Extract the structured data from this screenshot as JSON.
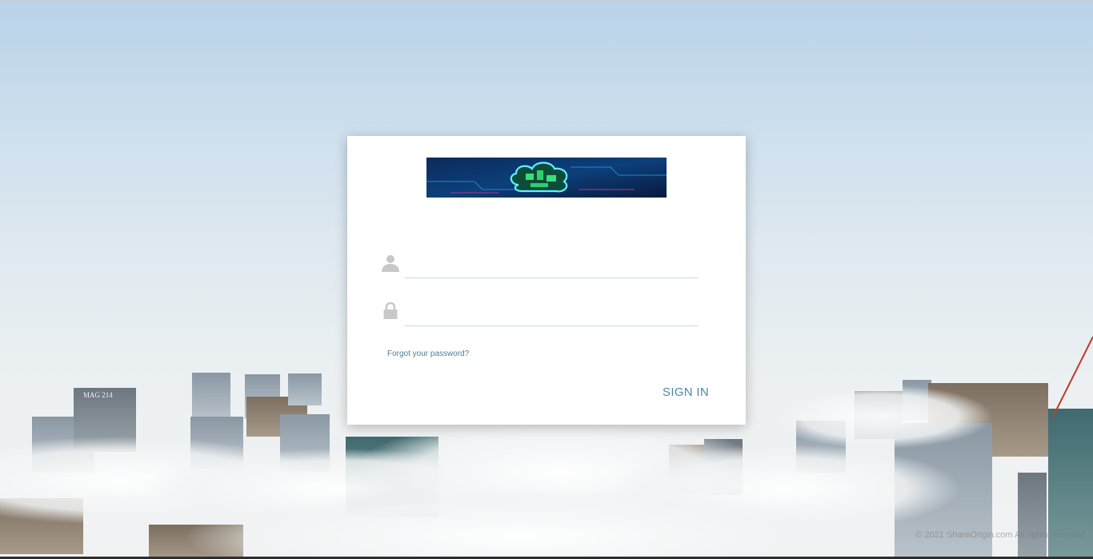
{
  "login": {
    "username_placeholder": "",
    "password_placeholder": "",
    "forgot_password_label": "Forgot your password?",
    "sign_in_label": "SIGN IN"
  },
  "icons": {
    "username": "user-icon",
    "password": "lock-icon",
    "logo": "cloud-circuit-logo"
  },
  "footer": {
    "copyright": "© 2021 ShareOrigin.com All rights reserved"
  },
  "colors": {
    "accent": "#4a8ba4",
    "link": "#4a7f94",
    "input_underline": "#c9d9de",
    "icon_gray": "#c8c8c8"
  }
}
